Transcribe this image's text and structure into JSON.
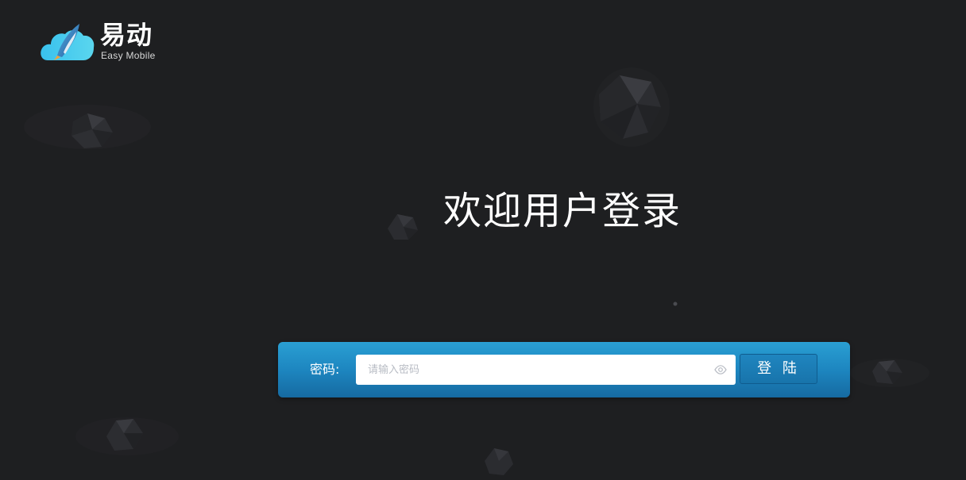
{
  "brand": {
    "name": "易动",
    "subtitle": "Easy Mobile",
    "logo_icon": "cloud-rocket-icon",
    "colors": {
      "cloud_start": "#39c1ee",
      "cloud_end": "#5ad6ee",
      "rocket": "#2b6fb0"
    }
  },
  "page": {
    "heading": "欢迎用户登录",
    "background": "#1e1f21"
  },
  "login": {
    "password_label": "密码:",
    "password_placeholder": "请输入密码",
    "password_value": "",
    "toggle_visibility_icon": "eye-icon",
    "submit_label": "登 陆",
    "bar_color": "#1d86c0"
  }
}
